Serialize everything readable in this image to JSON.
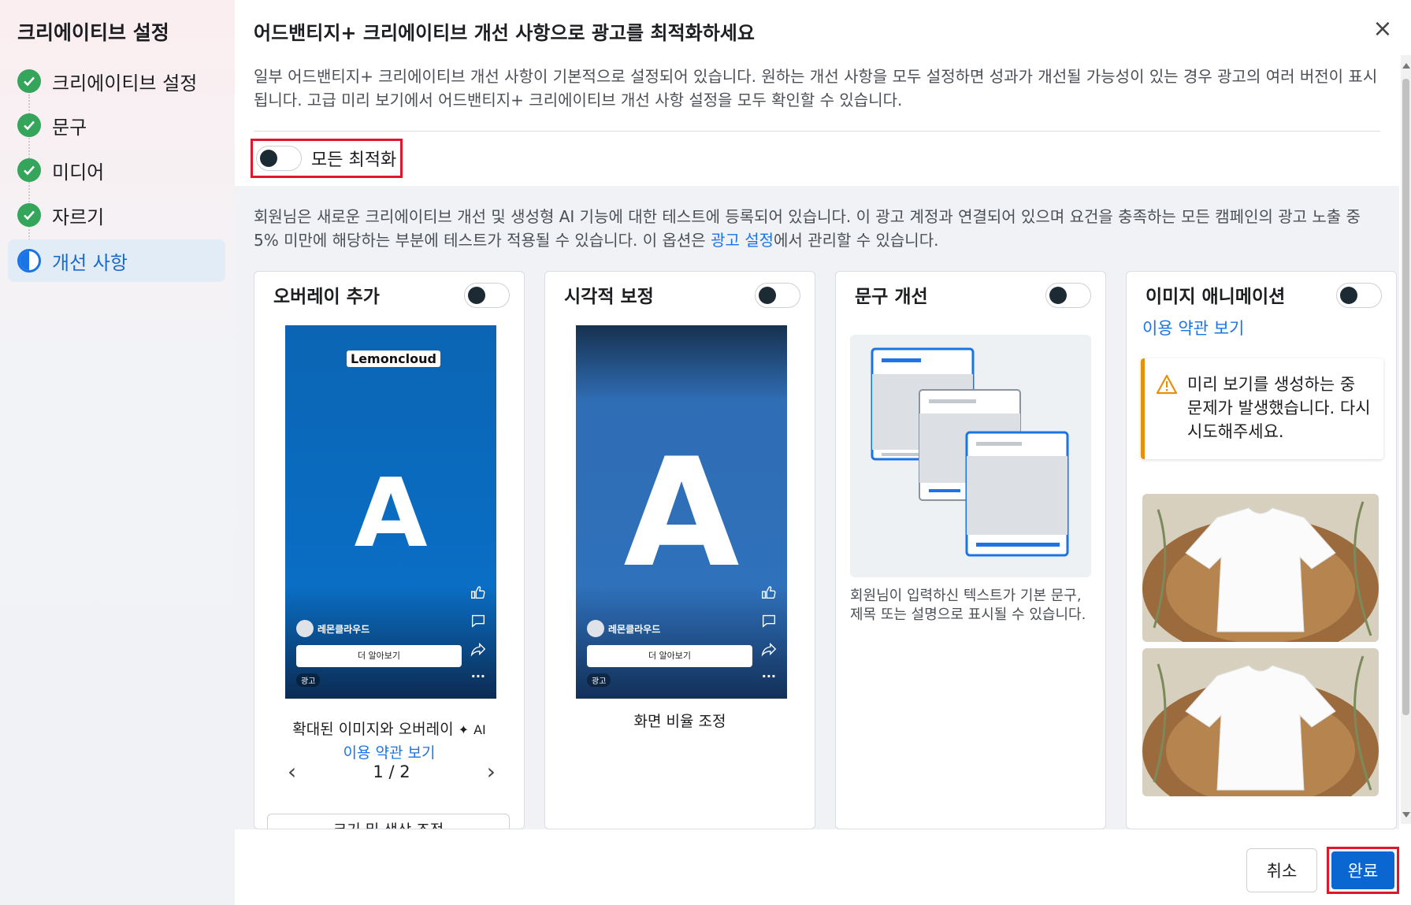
{
  "sidebar": {
    "title": "크리에이티브 설정",
    "steps": [
      {
        "label": "크리에이티브 설정",
        "status": "done"
      },
      {
        "label": "문구",
        "status": "done"
      },
      {
        "label": "미디어",
        "status": "done"
      },
      {
        "label": "자르기",
        "status": "done"
      },
      {
        "label": "개선 사항",
        "status": "active"
      }
    ]
  },
  "header": {
    "title": "어드밴티지+ 크리에이티브 개선 사항으로 광고를 최적화하세요",
    "close_icon": "close-icon"
  },
  "description": "일부 어드밴티지+ 크리에이티브 개선 사항이 기본적으로 설정되어 있습니다. 원하는 개선 사항을 모두 설정하면 성과가 개선될 가능성이 있는 경우 광고의 여러 버전이 표시됩니다. 고급 미리 보기에서 어드밴티지+ 크리에이티브 개선 사항 설정을 모두 확인할 수 있습니다.",
  "all_optimizations": {
    "label": "모든 최적화",
    "enabled": false
  },
  "notice": {
    "text_before": "회원님은 새로운 크리에이티브 개선 및 생성형 AI 기능에 대한 테스트에 등록되어 있습니다. 이 광고 계정과 연결되어 있으며 요건을 충족하는 모든 캠페인의 광고 노출 중 5% 미만에 해당하는 부분에 테스트가 적용될 수 있습니다. 이 옵션은 ",
    "link": "광고 설정",
    "text_after": "에서 관리할 수 있습니다."
  },
  "cards": {
    "overlay": {
      "title": "오버레이 추가",
      "enabled": false,
      "preview": {
        "brand": "Lemoncloud",
        "letter": "A",
        "account": "레몬클라우드",
        "cta": "더 알아보기",
        "ad_badge": "광고",
        "more": "···"
      },
      "caption": "확대된 이미지와 오버레이",
      "ai_label": "AI",
      "terms_link": "이용 약관 보기",
      "pager": "1 / 2",
      "partial_button": "크기 및 색상 조정"
    },
    "visual": {
      "title": "시각적 보정",
      "enabled": false,
      "preview": {
        "letter": "A",
        "account": "레몬클라우드",
        "cta": "더 알아보기",
        "ad_badge": "광고",
        "more": "···"
      },
      "caption": "화면 비율 조정"
    },
    "text": {
      "title": "문구 개선",
      "enabled": false,
      "body": "회원님이 입력하신 텍스트가 기본 문구, 제목 또는 설명으로 표시될 수 있습니다."
    },
    "animation": {
      "title": "이미지 애니메이션",
      "enabled": false,
      "terms_link": "이용 약관 보기",
      "warning": "미리 보기를 생성하는 중 문제가 발생했습니다. 다시 시도해주세요."
    }
  },
  "footer": {
    "cancel_label": "취소",
    "done_label": "완료"
  },
  "colors": {
    "accent": "#1b74e4",
    "success": "#35a55b",
    "warning": "#e4910e",
    "highlight": "#e0162b"
  }
}
